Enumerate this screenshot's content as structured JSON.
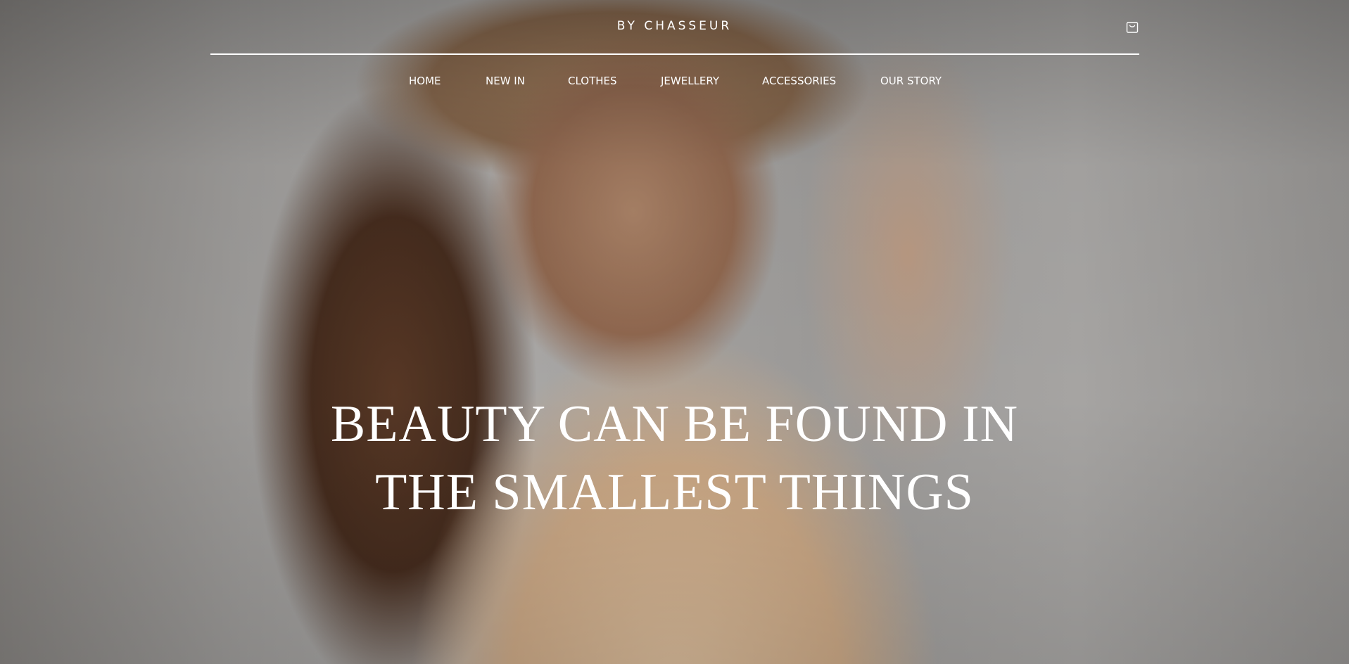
{
  "brand": {
    "name": "BY CHASSEUR"
  },
  "nav": {
    "items": [
      {
        "label": "HOME"
      },
      {
        "label": "NEW IN"
      },
      {
        "label": "CLOTHES"
      },
      {
        "label": "JEWELLERY"
      },
      {
        "label": "ACCESSORIES"
      },
      {
        "label": "OUR STORY"
      }
    ]
  },
  "cart": {
    "icon": "shopping-bag-icon"
  },
  "hero": {
    "headline_line1": "BEAUTY CAN BE FOUND IN",
    "headline_line2": "THE SMALLEST THINGS",
    "image": "woman-in-hat-photo"
  },
  "colors": {
    "text": "#ffffff",
    "header_rule": "#ffffff"
  }
}
